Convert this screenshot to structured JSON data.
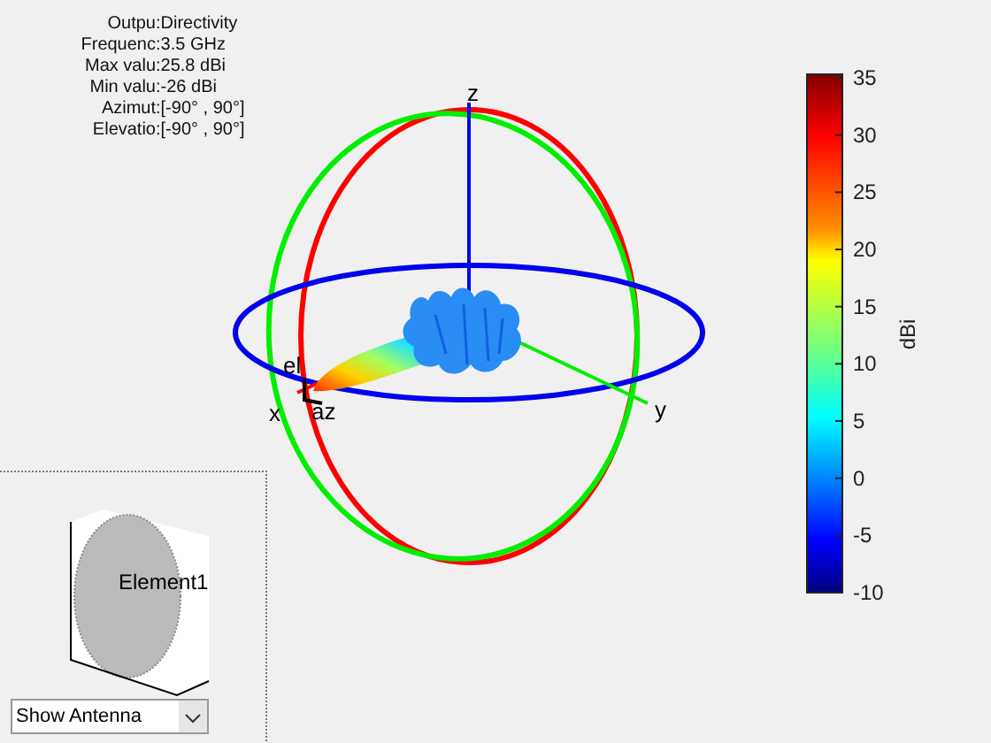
{
  "info": [
    {
      "label": "Outpu",
      "value": ":Directivity"
    },
    {
      "label": "Frequenc",
      "value": ":3.5 GHz"
    },
    {
      "label": "Max valu",
      "value": ":25.8 dBi"
    },
    {
      "label": "Min valu",
      "value": ":-26 dBi"
    },
    {
      "label": "Azimut",
      "value": ":[-90° , 90°]"
    },
    {
      "label": "Elevatio",
      "value": ":[-90° , 90°]"
    }
  ],
  "axis_labels": {
    "x": "x",
    "y": "y",
    "z": "z",
    "el": "el",
    "az": "az"
  },
  "colorbar": {
    "label": "dBi",
    "ticks": [
      "35",
      "30",
      "25",
      "20",
      "15",
      "10",
      "5",
      "0",
      "-5",
      "-10"
    ]
  },
  "antenna_preview": {
    "label": "Element1"
  },
  "dropdown": {
    "value": "Show Antenna"
  }
}
